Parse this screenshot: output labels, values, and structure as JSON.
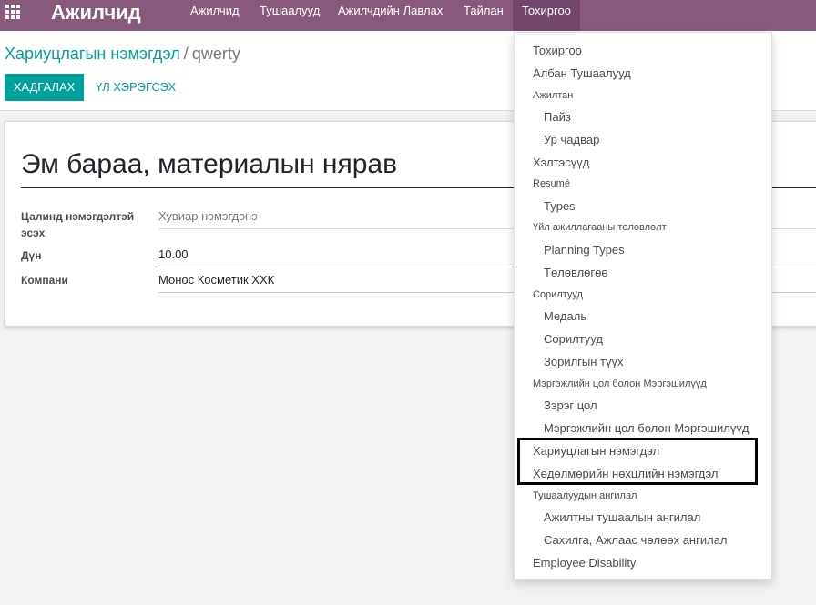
{
  "navbar": {
    "brand": "Ажилчид",
    "menu": [
      "Ажилчид",
      "Тушаалууд",
      "Ажилчдийн Лавлах",
      "Тайлан",
      "Тохиргоо"
    ]
  },
  "breadcrumb": {
    "parent": "Хариуцлагын нэмэгдэл",
    "separator": "/",
    "current": "qwerty"
  },
  "buttons": {
    "save": "ХАДГАЛАХ",
    "action": "ҮЛ ХЭРЭГСЭХ"
  },
  "form": {
    "title": "Эм бараа, материалын нярав",
    "fields": [
      {
        "label": "Цалинд нэмэгдэлтэй эсэх",
        "value": "Хувиар нэмэгдэнэ"
      },
      {
        "label": "Дүн",
        "value": "10.00"
      },
      {
        "label": "Компани",
        "value": "Монос Косметик ХХК"
      }
    ]
  },
  "dropdown": {
    "items": [
      {
        "text": "Тохиргоо",
        "kind": "item"
      },
      {
        "text": "Албан Тушаалууд",
        "kind": "item"
      },
      {
        "text": "Ажилтан",
        "kind": "header"
      },
      {
        "text": "Пайз",
        "kind": "sub"
      },
      {
        "text": "Ур чадвар",
        "kind": "sub"
      },
      {
        "text": "Хэлтэсүүд",
        "kind": "item"
      },
      {
        "text": "Resumé",
        "kind": "header"
      },
      {
        "text": "Types",
        "kind": "sub"
      },
      {
        "text": "Үйл ажиллагааны төлөвлөлт",
        "kind": "header"
      },
      {
        "text": "Planning Types",
        "kind": "sub"
      },
      {
        "text": "Төлөвлөгөө",
        "kind": "sub"
      },
      {
        "text": "Сорилтууд",
        "kind": "header"
      },
      {
        "text": "Медаль",
        "kind": "sub"
      },
      {
        "text": "Сорилтууд",
        "kind": "sub"
      },
      {
        "text": "Зорилгын түүх",
        "kind": "sub"
      },
      {
        "text": "Мэргэжлийн цол болон Мэргэшилүүд",
        "kind": "header"
      },
      {
        "text": "Зэрэг цол",
        "kind": "sub"
      },
      {
        "text": "Мэргэжлийн цол болон Мэргэшилүүд",
        "kind": "sub"
      },
      {
        "text": "Хариуцлагын нэмэгдэл",
        "kind": "item"
      },
      {
        "text": "Хөдөлмөрийн нөхцлийн нэмэгдэл",
        "kind": "item"
      },
      {
        "text": "Тушаалуудын ангилал",
        "kind": "header"
      },
      {
        "text": "Ажилтны тушаалын ангилал",
        "kind": "sub"
      },
      {
        "text": "Сахилга, Ажлаас чөлөөх ангилал",
        "kind": "sub"
      },
      {
        "text": "Employee Disability",
        "kind": "item"
      }
    ]
  },
  "colors": {
    "navbar": "#875a7b",
    "navbar_active": "#71486a",
    "accent": "#00a09d"
  }
}
